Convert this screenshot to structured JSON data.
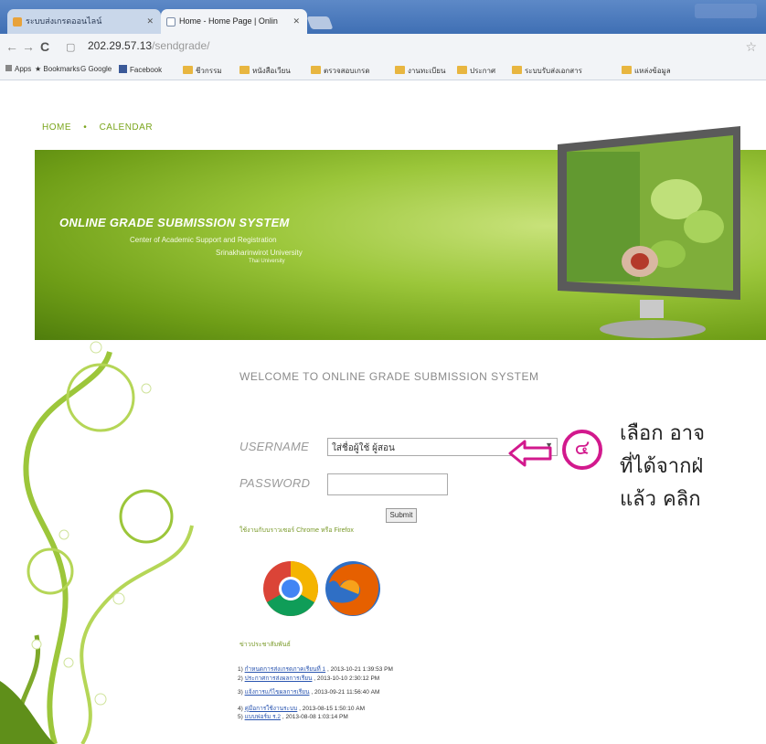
{
  "browser": {
    "tabs": [
      {
        "label": "ระบบส่งเกรดออนไลน์"
      },
      {
        "label": "Home - Home Page | Onlin"
      }
    ],
    "url_host": "202.29.57.13",
    "url_path": "/sendgrade/",
    "bookmarks": [
      "Apps",
      "Bookmarks",
      "Google",
      "Facebook",
      "ชีวกรรม",
      "หนังสือเวียน",
      "ตรวจสอบเกรด",
      "งานทะเบียน",
      "ประกาศ",
      "ระบบรับส่งเอกสาร",
      "แหล่งข้อมูล"
    ]
  },
  "page": {
    "nav": {
      "home": "HOME",
      "calendar": "CALENDAR"
    },
    "banner": {
      "title": "ONLINE GRADE SUBMISSION SYSTEM",
      "subtitle1": "Center of Academic Support and Registration",
      "subtitle2": "Srinakharinwirot University",
      "subtitle3": "Thai University"
    },
    "welcome": "WELCOME TO ONLINE GRADE SUBMISSION SYSTEM",
    "username_label": "USERNAME",
    "username_value": "ใส่ชื่อผู้ใช้  ผู้สอน",
    "password_label": "PASSWORD",
    "submit_label": "Submit",
    "browser_hint": "ใช้งานกับบราวเซอร์ Chrome หรือ Firefox",
    "news_heading": "ข่าวประชาสัมพันธ์",
    "news": [
      {
        "title": "กำหนดการส่งเกรดภาคเรียนที่ 1",
        "date": "2013-10-21 1:39:53 PM"
      },
      {
        "title": "ประกาศการส่งผลการเรียน",
        "date": "2013-10-10 2:30:12 PM"
      },
      {
        "title": "แจ้งการแก้ไขผลการเรียน",
        "date": "2013-09-21 11:56:40 AM"
      },
      {
        "title": "คู่มือการใช้งานระบบ",
        "date": "2013-08-15 1:50:10 AM"
      },
      {
        "title": "แบบฟอร์ม ร.2",
        "date": "2013-08-08 1:03:14 PM"
      }
    ]
  },
  "annotation": {
    "line1": "เลือก อาจ",
    "line2": "ที่ได้จากฝ่",
    "line3": "แล้ว คลิก",
    "step_number": "๔",
    "accent_color": "#d2198d"
  }
}
